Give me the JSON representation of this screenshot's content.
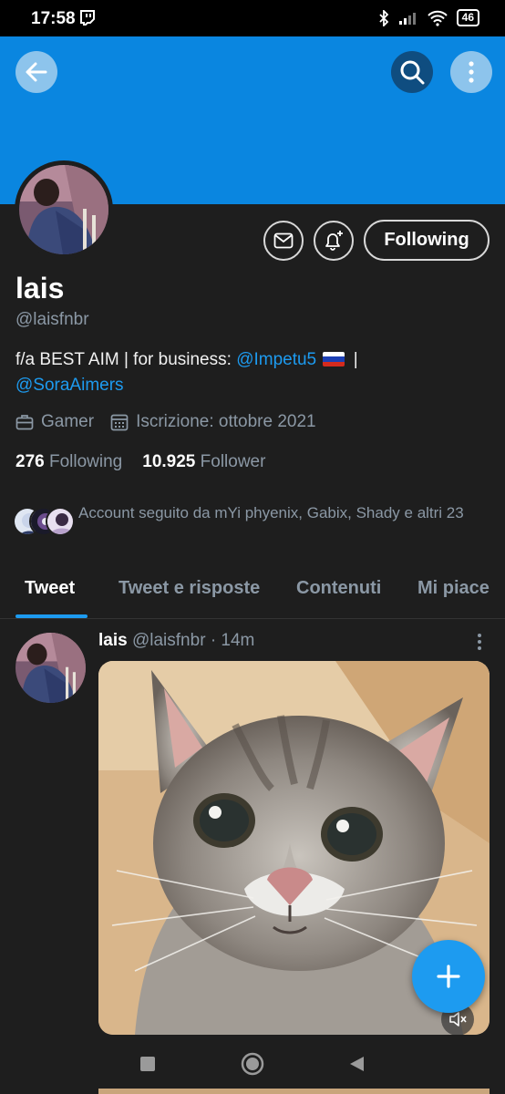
{
  "status_bar": {
    "time": "17:58",
    "battery": "46",
    "icons": [
      "twitch-icon",
      "bluetooth-icon",
      "signal-icon",
      "wifi-icon",
      "battery-icon"
    ]
  },
  "header": {
    "banner_color": "#0a86e0",
    "icons": [
      "back-arrow-icon",
      "search-icon",
      "more-vertical-icon"
    ]
  },
  "profile": {
    "name": "lais",
    "handle": "@laisfnbr",
    "bio_prefix": "f/a BEST AIM | for business: ",
    "bio_link1": "@Impetu5",
    "bio_sep": " |",
    "bio_link2": "@SoraAimers",
    "category": "Gamer",
    "joined": "Iscrizione: ottobre 2021",
    "following_count": "276",
    "following_label": "Following",
    "followers_count": "10.925",
    "followers_label": "Follower",
    "followed_by": "Account seguito da mYi phyenix, Gabix, Shady e altri 23",
    "follow_button": "Following"
  },
  "tabs": [
    "Tweet",
    "Tweet e risposte",
    "Contenuti",
    "Mi piace"
  ],
  "active_tab": "Tweet",
  "tweet": {
    "author": "lais",
    "handle": "@laisfnbr",
    "time": "· 14m"
  },
  "colors": {
    "background": "#1e1e1e",
    "accent": "#1d9bf0",
    "muted_text": "#8b98a5"
  }
}
